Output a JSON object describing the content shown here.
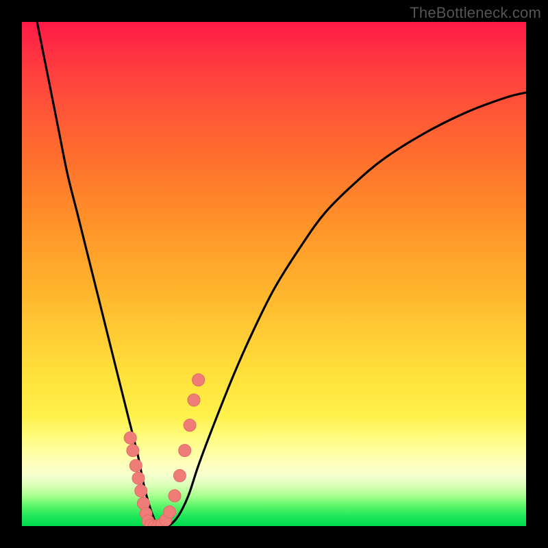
{
  "watermark": "TheBottleneck.com",
  "colors": {
    "background": "#000000",
    "curve": "#000000",
    "marker_fill": "#f07c78",
    "marker_stroke": "#e06a66"
  },
  "chart_data": {
    "type": "line",
    "title": "",
    "xlabel": "",
    "ylabel": "",
    "xlim": [
      0,
      100
    ],
    "ylim": [
      0,
      100
    ],
    "series": [
      {
        "name": "bottleneck-curve",
        "x": [
          3,
          5,
          7,
          9,
          11,
          13,
          15,
          17,
          19,
          21,
          23,
          24,
          25,
          26,
          27,
          29,
          31,
          33,
          35,
          38,
          42,
          46,
          50,
          55,
          60,
          66,
          72,
          80,
          88,
          96,
          100
        ],
        "y": [
          100,
          90,
          80,
          70,
          62,
          54,
          46,
          38,
          30,
          22,
          14,
          9,
          5,
          2,
          0,
          0,
          2,
          6,
          12,
          20,
          30,
          39,
          47,
          55,
          62,
          68,
          73,
          78,
          82,
          85,
          86
        ]
      }
    ],
    "markers": {
      "name": "highlight-points",
      "x": [
        21.5,
        22.0,
        22.6,
        23.1,
        23.6,
        24.1,
        24.6,
        25.0,
        25.6,
        26.3,
        27.0,
        27.8,
        28.5,
        29.3,
        30.3,
        31.3,
        32.3,
        33.3,
        34.1,
        35.0
      ],
      "y": [
        17.5,
        15.0,
        12.0,
        9.5,
        7.0,
        4.5,
        2.5,
        1.0,
        0.2,
        0.0,
        0.0,
        0.4,
        1.2,
        2.8,
        6.0,
        10.0,
        15.0,
        20.0,
        25.0,
        29.0
      ]
    }
  }
}
